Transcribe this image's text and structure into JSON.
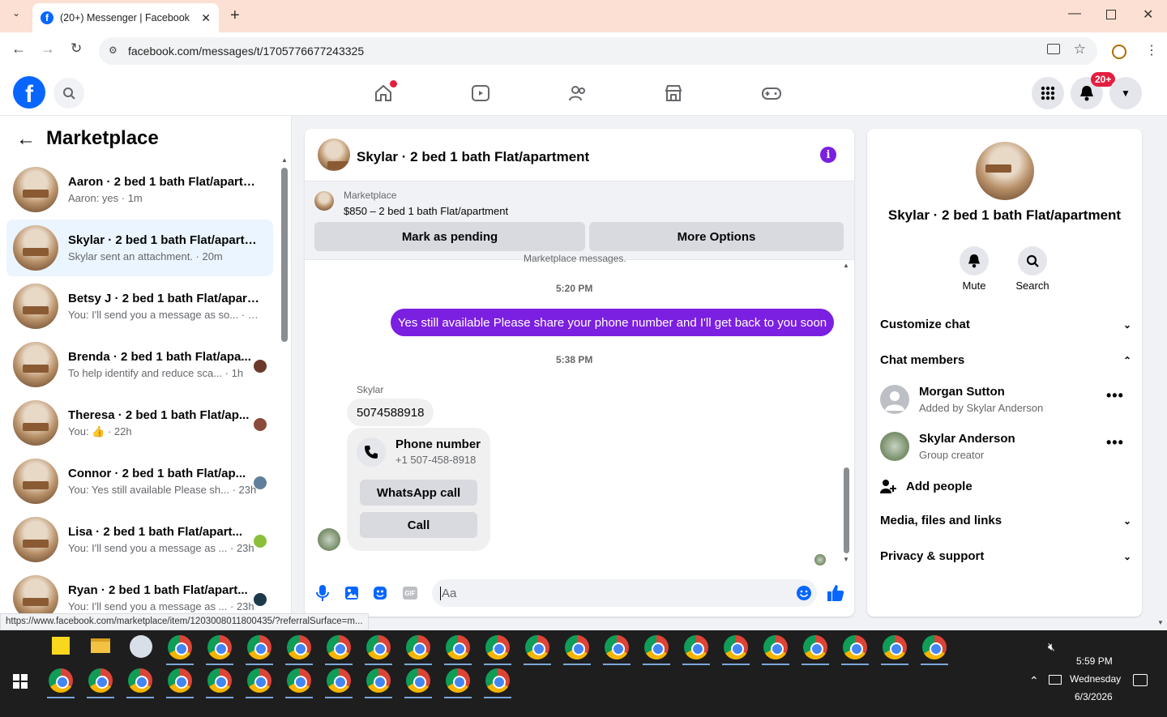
{
  "browser": {
    "tab_title": "(20+) Messenger | Facebook",
    "url": "facebook.com/messages/t/1705776677243325",
    "status_url": "https://www.facebook.com/marketplace/item/1203008011800435/?referralSurface=m..."
  },
  "fb": {
    "notif_badge": "20+"
  },
  "sidebar": {
    "title": "Marketplace",
    "conversations": [
      {
        "name": "Aaron · 2 bed 1 bath Flat/apartm...",
        "sub": "Aaron: yes · 1m"
      },
      {
        "name": "Skylar · 2 bed 1 bath Flat/apartm...",
        "sub": "Skylar sent an attachment. · 20m"
      },
      {
        "name": "Betsy J · 2 bed 1 bath Flat/apart...",
        "sub": "You: I'll send you a message as so... · 39m"
      },
      {
        "name": "Brenda · 2 bed 1 bath Flat/apa...",
        "sub": "To help identify and reduce sca...  · 1h"
      },
      {
        "name": "Theresa · 2 bed 1 bath Flat/ap...",
        "sub": "You: 👍 · 22h"
      },
      {
        "name": "Connor · 2 bed 1 bath Flat/ap...",
        "sub": "You: Yes still available Please sh... · 23h"
      },
      {
        "name": "Lisa · 2 bed 1 bath Flat/apart...",
        "sub": "You: I'll send you a message as ... · 23h"
      },
      {
        "name": "Ryan · 2 bed 1 bath Flat/apart...",
        "sub": "You: I'll send you a message as ... · 23h"
      }
    ]
  },
  "chat": {
    "title": "Skylar · 2 bed 1 bath Flat/apartment",
    "listing_source": "Marketplace",
    "listing_desc": "$850 – 2 bed 1 bath Flat/apartment",
    "mark_pending": "Mark as pending",
    "more_options": "More Options",
    "cut_text": "Marketplace messages.",
    "time1": "5:20 PM",
    "outgoing": "Yes still available Please share your phone number and I'll get back to you soon",
    "time2": "5:38 PM",
    "sender": "Skylar",
    "incoming_number": "5074588918",
    "phone_label": "Phone number",
    "phone_value": "+1 507-458-8918",
    "whatsapp": "WhatsApp call",
    "call": "Call",
    "input_placeholder": "Aa",
    "gif_label": "GIF"
  },
  "details": {
    "name": "Skylar · 2 bed 1 bath Flat/apartment",
    "mute": "Mute",
    "search": "Search",
    "customize": "Customize chat",
    "members": "Chat members",
    "member1_name": "Morgan Sutton",
    "member1_sub": "Added by Skylar Anderson",
    "member2_name": "Skylar Anderson",
    "member2_sub": "Group creator",
    "add_people": "Add people",
    "media": "Media, files and links",
    "privacy": "Privacy & support"
  },
  "taskbar": {
    "time": "5:59 PM",
    "day": "Wednesday",
    "date": "6/3/2026"
  },
  "colors": {
    "accent": "#7b1fe0",
    "fb_blue": "#0866ff",
    "badge": "#e41e3f"
  }
}
